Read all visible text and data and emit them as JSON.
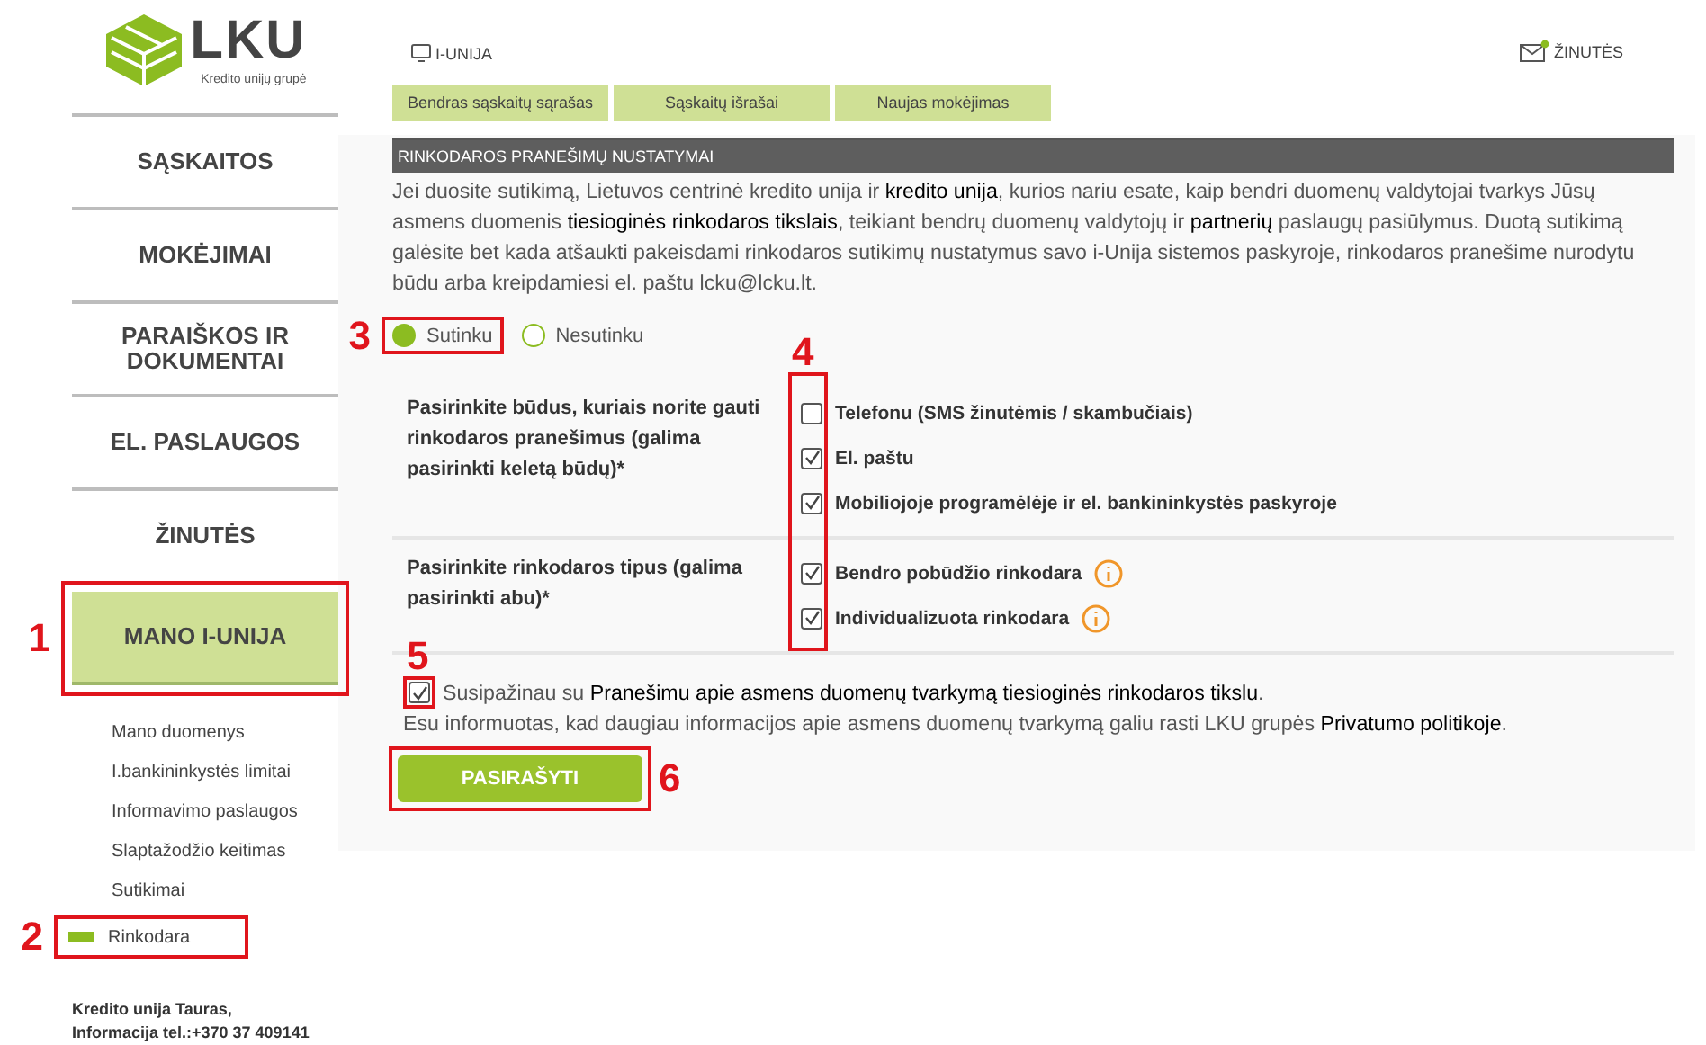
{
  "logo": {
    "name": "LKU",
    "tagline": "Kredito unijų grupė"
  },
  "nav": [
    {
      "label": "SĄSKAITOS",
      "selected": false
    },
    {
      "label": "MOKĖJIMAI",
      "selected": false
    },
    {
      "label": "PARAIŠKOS IR DOKUMENTAI",
      "selected": false
    },
    {
      "label": "EL. PASLAUGOS",
      "selected": false
    },
    {
      "label": "ŽINUTĖS",
      "selected": false
    },
    {
      "label": "MANO I-UNIJA",
      "selected": true,
      "callout": {
        "label": "1"
      }
    }
  ],
  "subnav": [
    {
      "label": "Mano duomenys",
      "selected": false
    },
    {
      "label": "I.bankininkystės limitai",
      "selected": false
    },
    {
      "label": "Informavimo paslaugos",
      "selected": false
    },
    {
      "label": "Slaptažodžio keitimas",
      "selected": false
    },
    {
      "label": "Sutikimai",
      "selected": false
    },
    {
      "label": "Rinkodara",
      "selected": true,
      "callout": {
        "label": "2"
      }
    }
  ],
  "footer": [
    "Kredito unija Tauras,",
    "Informacija tel.:+370 37 409141"
  ],
  "header": {
    "app": "I-UNIJA",
    "messages": "ŽINUTĖS",
    "unread": true
  },
  "tabs": [
    "Bendras sąskaitų sąrašas",
    "Sąskaitų išrašai",
    "Naujas mokėjimas"
  ],
  "section": {
    "title": "RINKODAROS PRANEŠIMŲ NUSTATYMAI",
    "intro": [
      {
        "kind": "text",
        "text": "Jei duosite sutikimą, Lietuvos centrinė kredito unija ir "
      },
      {
        "kind": "link",
        "text": "kredito unija"
      },
      {
        "kind": "text",
        "text": ", kurios nariu esate, kaip bendri duomenų valdytojai tvarkys Jūsų asmens duomenis "
      },
      {
        "kind": "link",
        "text": "tiesioginės rinkodaros tikslais"
      },
      {
        "kind": "text",
        "text": ", teikiant bendrų duomenų valdytojų ir "
      },
      {
        "kind": "link",
        "text": "partnerių"
      },
      {
        "kind": "text",
        "text": " paslaugų pasiūlymus. Duotą sutikimą galėsite bet kada atšaukti pakeisdami rinkodaros sutikimų nustatymus savo i-Unija sistemos paskyroje, rinkodaros pranešime nurodytu būdu arba kreipdamiesi el. paštu lcku@lcku.lt."
      }
    ],
    "consent": {
      "callout": {
        "label": "3"
      },
      "options": [
        {
          "label": "Sutinku",
          "selected": true
        },
        {
          "label": "Nesutinku",
          "selected": false
        }
      ]
    },
    "groups_callout": {
      "label": "4"
    },
    "groups": [
      {
        "question": "Pasirinkite būdus, kuriais norite gauti rinkodaros pranešimus (galima pasirinkti keletą būdų)*",
        "options": [
          {
            "label": "Telefonu (SMS žinutėmis / skambučiais)",
            "checked": false,
            "info": false
          },
          {
            "label": "El. paštu",
            "checked": true,
            "info": false
          },
          {
            "label": "Mobiliojoje programėlėje ir el. bankininkystės paskyroje",
            "checked": true,
            "info": false
          }
        ]
      },
      {
        "question": "Pasirinkite rinkodaros tipus (galima pasirinkti abu)*",
        "options": [
          {
            "label": "Bendro pobūdžio rinkodara",
            "checked": true,
            "info": true
          },
          {
            "label": "Individualizuota rinkodara",
            "checked": true,
            "info": true
          }
        ]
      }
    ],
    "agreement": {
      "checked": true,
      "callout": {
        "label": "5"
      },
      "text": [
        {
          "kind": "text",
          "text": "Susipažinau su "
        },
        {
          "kind": "link",
          "text": "Pranešimu apie asmens duomenų tvarkymą tiesioginės rinkodaros tikslu"
        },
        {
          "kind": "text",
          "text": "."
        }
      ],
      "note": [
        {
          "kind": "text",
          "text": "Esu informuotas, kad daugiau informacijos apie asmens duomenų tvarkymą galiu rasti LKU grupės "
        },
        {
          "kind": "link",
          "text": "Privatumo politikoje"
        },
        {
          "kind": "text",
          "text": "."
        }
      ]
    },
    "submit": {
      "label": "PASIRAŠYTI",
      "callout": {
        "label": "6"
      }
    }
  }
}
